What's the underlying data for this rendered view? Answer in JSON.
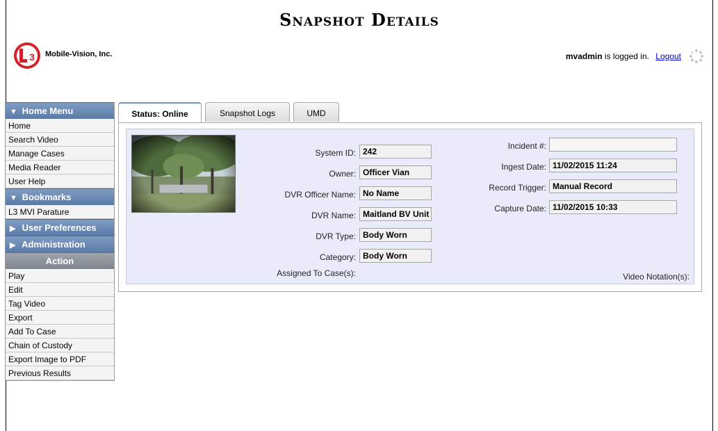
{
  "header": {
    "title": "Snapshot Details",
    "brand": "Mobile-Vision, Inc.",
    "logo_text": "L3",
    "user": "mvadmin",
    "logged_in_text": "is logged in.",
    "logout_label": "Logout"
  },
  "nav": {
    "home_menu": {
      "label": "Home Menu",
      "items": [
        "Home",
        "Search Video",
        "Manage Cases",
        "Media Reader",
        "User Help"
      ]
    },
    "bookmarks": {
      "label": "Bookmarks",
      "items": [
        "L3 MVI Parature"
      ]
    },
    "user_prefs": {
      "label": "User Preferences"
    },
    "administration": {
      "label": "Administration"
    },
    "action": {
      "label": "Action",
      "items": [
        "Play",
        "Edit",
        "Tag Video",
        "Export",
        "Add To Case",
        "Chain of Custody",
        "Export Image to PDF",
        "Previous Results"
      ]
    }
  },
  "tabs": [
    {
      "label": "Status: Online",
      "active": true
    },
    {
      "label": "Snapshot Logs",
      "active": false
    },
    {
      "label": "UMD",
      "active": false
    }
  ],
  "details": {
    "system_id": {
      "label": "System ID:",
      "value": "242"
    },
    "owner": {
      "label": "Owner:",
      "value": "Officer Vian"
    },
    "dvr_officer": {
      "label": "DVR Officer Name:",
      "value": "No Name"
    },
    "dvr_name": {
      "label": "DVR Name:",
      "value": "Maitland BV Unit"
    },
    "dvr_type": {
      "label": "DVR Type:",
      "value": "Body Worn"
    },
    "category": {
      "label": "Category:",
      "value": "Body Worn"
    },
    "assigned": {
      "label": "Assigned To Case(s):"
    },
    "incident": {
      "label": "Incident #:",
      "value": ""
    },
    "ingest_date": {
      "label": "Ingest Date:",
      "value": "11/02/2015 11:24"
    },
    "record_trigger": {
      "label": "Record Trigger:",
      "value": "Manual Record"
    },
    "capture_date": {
      "label": "Capture Date:",
      "value": "11/02/2015 10:33"
    },
    "video_notation": {
      "label": "Video Notation(s):"
    }
  },
  "colors": {
    "nav_header": "#6886b2",
    "panel_bg": "#e9ebfa",
    "link": "#0000cc",
    "logo_red": "#d2232a"
  }
}
